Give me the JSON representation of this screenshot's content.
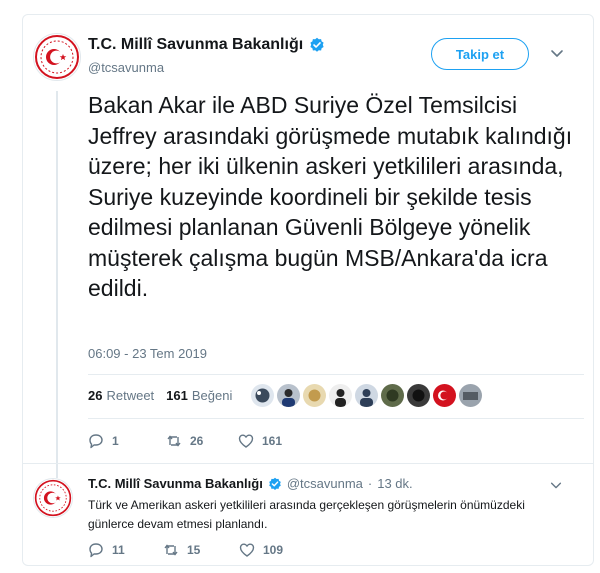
{
  "tweet": {
    "author_name": "T.C. Millî Savunma Bakanlığı",
    "handle": "@tcsavunma",
    "follow_label": "Takip et",
    "text": "Bakan Akar ile ABD Suriye Özel Temsilcisi Jeffrey arasındaki görüşmede mutabık kalındığı üzere; her iki ülkenin askeri yetkilileri arasında, Suriye kuzeyinde koordineli bir şekilde tesis edilmesi planlanan Güvenli Bölgeye yönelik müşterek çalışma bugün MSB/Ankara'da icra edildi.",
    "timestamp": "06:09 - 23 Tem 2019",
    "retweets_count": "26",
    "retweets_label": "Retweet",
    "likes_count": "161",
    "likes_label": "Beğeni",
    "actions": {
      "replies": "1",
      "retweets": "26",
      "likes": "161"
    }
  },
  "reply": {
    "author_name": "T.C. Millî Savunma Bakanlığı",
    "handle": "@tcsavunma",
    "separator": "·",
    "time_ago": "13 dk.",
    "text": "Türk ve Amerikan askeri yetkilileri arasında gerçekleşen görüşmelerin önümüzdeki günlerce devam etmesi planlandı.",
    "actions": {
      "replies": "11",
      "retweets": "15",
      "likes": "109"
    }
  },
  "colors": {
    "accent": "#1da1f2",
    "muted": "#657786",
    "seal_red": "#d3121f",
    "text": "#14171a"
  },
  "icons": [
    "msb-seal-icon",
    "verified-badge-icon",
    "chevron-down-icon",
    "reply-icon",
    "retweet-icon",
    "like-icon"
  ]
}
